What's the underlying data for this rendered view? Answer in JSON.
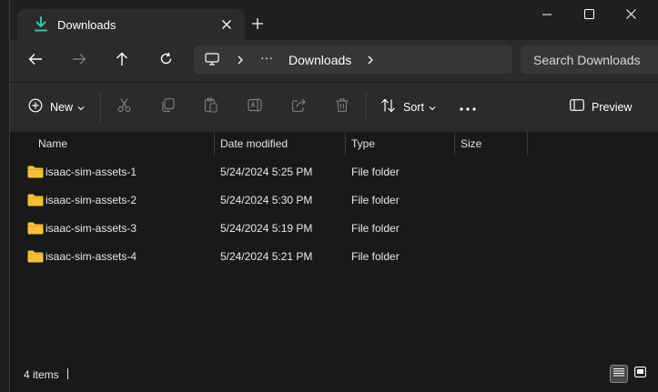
{
  "tab": {
    "title": "Downloads",
    "icon": "download-icon"
  },
  "window_controls": [
    "minimize-icon",
    "maximize-icon",
    "close-icon"
  ],
  "address": {
    "icon": "this-pc-icon",
    "overflow": "···",
    "current": "Downloads"
  },
  "search": {
    "placeholder": "Search Downloads"
  },
  "commands": {
    "new_label": "New",
    "sort_label": "Sort",
    "preview_label": "Preview"
  },
  "columns": {
    "name": "Name",
    "date": "Date modified",
    "type": "Type",
    "size": "Size"
  },
  "files": [
    {
      "name": "isaac-sim-assets-1",
      "date": "5/24/2024 5:25 PM",
      "type": "File folder",
      "size": ""
    },
    {
      "name": "isaac-sim-assets-2",
      "date": "5/24/2024 5:30 PM",
      "type": "File folder",
      "size": ""
    },
    {
      "name": "isaac-sim-assets-3",
      "date": "5/24/2024 5:19 PM",
      "type": "File folder",
      "size": ""
    },
    {
      "name": "isaac-sim-assets-4",
      "date": "5/24/2024 5:21 PM",
      "type": "File folder",
      "size": ""
    }
  ],
  "status": {
    "item_count": "4 items"
  },
  "colors": {
    "accent": "#4cc2ff",
    "download_icon": "#36c3a6",
    "folder": "#f5c13b"
  }
}
